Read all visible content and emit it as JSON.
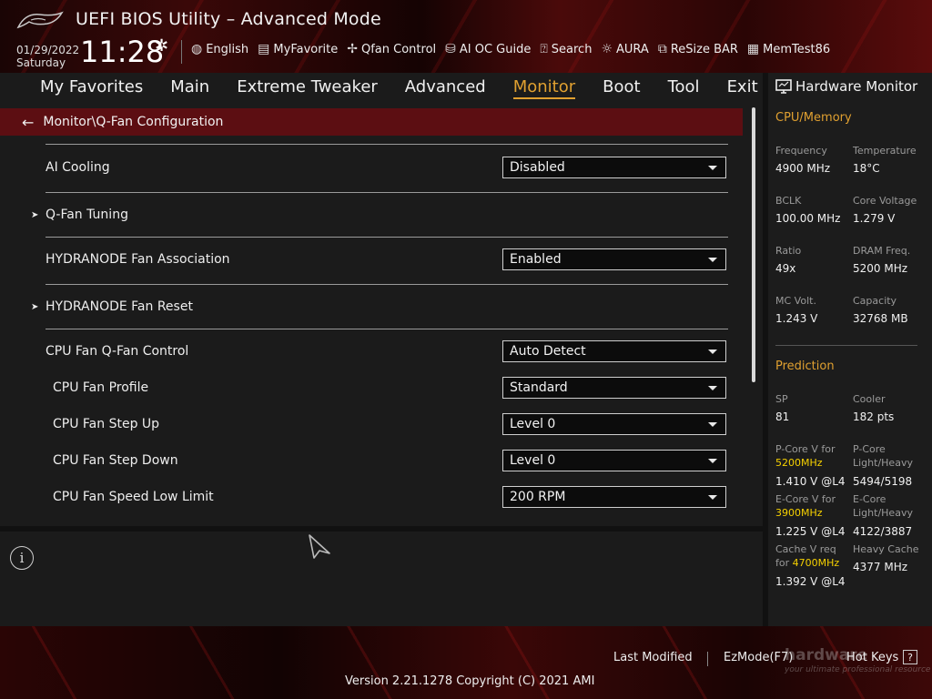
{
  "header": {
    "title": "UEFI BIOS Utility – Advanced Mode",
    "date": "01/29/2022",
    "day": "Saturday",
    "time": "11:28",
    "tools": [
      {
        "label": "English",
        "icon": "globe-icon"
      },
      {
        "label": "MyFavorite",
        "icon": "favorite-icon"
      },
      {
        "label": "Qfan Control",
        "icon": "fan-icon"
      },
      {
        "label": "AI OC Guide",
        "icon": "ai-chip-icon"
      },
      {
        "label": "Search",
        "icon": "help-search-icon"
      },
      {
        "label": "AURA",
        "icon": "aura-light-icon"
      },
      {
        "label": "ReSize BAR",
        "icon": "resize-bar-icon"
      },
      {
        "label": "MemTest86",
        "icon": "memory-icon"
      }
    ]
  },
  "menu": {
    "items": [
      "My Favorites",
      "Main",
      "Extreme Tweaker",
      "Advanced",
      "Monitor",
      "Boot",
      "Tool",
      "Exit"
    ],
    "active": "Monitor"
  },
  "breadcrumb": "Monitor\\Q-Fan Configuration",
  "settings": {
    "ai_cooling": {
      "label": "AI Cooling",
      "value": "Disabled"
    },
    "qfan_tuning": {
      "label": "Q-Fan Tuning"
    },
    "hydranode_assoc": {
      "label": "HYDRANODE Fan Association",
      "value": "Enabled"
    },
    "hydranode_reset": {
      "label": "HYDRANODE Fan Reset"
    },
    "cpu_fan_control": {
      "label": "CPU Fan Q-Fan Control",
      "value": "Auto Detect"
    },
    "cpu_fan_profile": {
      "label": "CPU Fan Profile",
      "value": "Standard"
    },
    "cpu_fan_step_up": {
      "label": "CPU Fan Step Up",
      "value": "Level 0"
    },
    "cpu_fan_step_down": {
      "label": "CPU Fan Step Down",
      "value": "Level 0"
    },
    "cpu_fan_low_limit": {
      "label": "CPU Fan Speed Low Limit",
      "value": "200 RPM"
    }
  },
  "help": {
    "icon": "info-icon"
  },
  "hardware_monitor": {
    "title": "Hardware Monitor",
    "cpu_memory": {
      "heading": "CPU/Memory",
      "frequency": {
        "label": "Frequency",
        "value": "4900 MHz"
      },
      "temperature": {
        "label": "Temperature",
        "value": "18°C"
      },
      "bclk": {
        "label": "BCLK",
        "value": "100.00 MHz"
      },
      "core_voltage": {
        "label": "Core Voltage",
        "value": "1.279 V"
      },
      "ratio": {
        "label": "Ratio",
        "value": "49x"
      },
      "dram_freq": {
        "label": "DRAM Freq.",
        "value": "5200 MHz"
      },
      "mc_volt": {
        "label": "MC Volt.",
        "value": "1.243 V"
      },
      "capacity": {
        "label": "Capacity",
        "value": "32768 MB"
      }
    },
    "prediction": {
      "heading": "Prediction",
      "sp": {
        "label": "SP",
        "value": "81"
      },
      "cooler": {
        "label": "Cooler",
        "value": "182 pts"
      },
      "pcore_v": {
        "label_prefix": "P-Core V for",
        "label_freq": "5200MHz",
        "value": "1.410 V @L4"
      },
      "pcore_lh": {
        "label": "P-Core Light/Heavy",
        "value": "5494/5198"
      },
      "ecore_v": {
        "label_prefix": "E-Core V for",
        "label_freq": "3900MHz",
        "value": "1.225 V @L4"
      },
      "ecore_lh": {
        "label": "E-Core Light/Heavy",
        "value": "4122/3887"
      },
      "cache_v": {
        "label_prefix": "Cache V req",
        "label_for": "for",
        "label_freq": "4700MHz",
        "value": "1.392 V @L4"
      },
      "heavy_cache": {
        "label": "Heavy Cache",
        "value": "4377 MHz"
      }
    }
  },
  "footer": {
    "last_modified": "Last Modified",
    "ez_mode": "EzMode(F7)",
    "hot_keys": "Hot Keys",
    "hot_keys_key": "?",
    "version": "Version 2.21.1278 Copyright (C) 2021 AMI",
    "watermark": "hardware",
    "watermark_sub": "your ultimate professional resource"
  }
}
